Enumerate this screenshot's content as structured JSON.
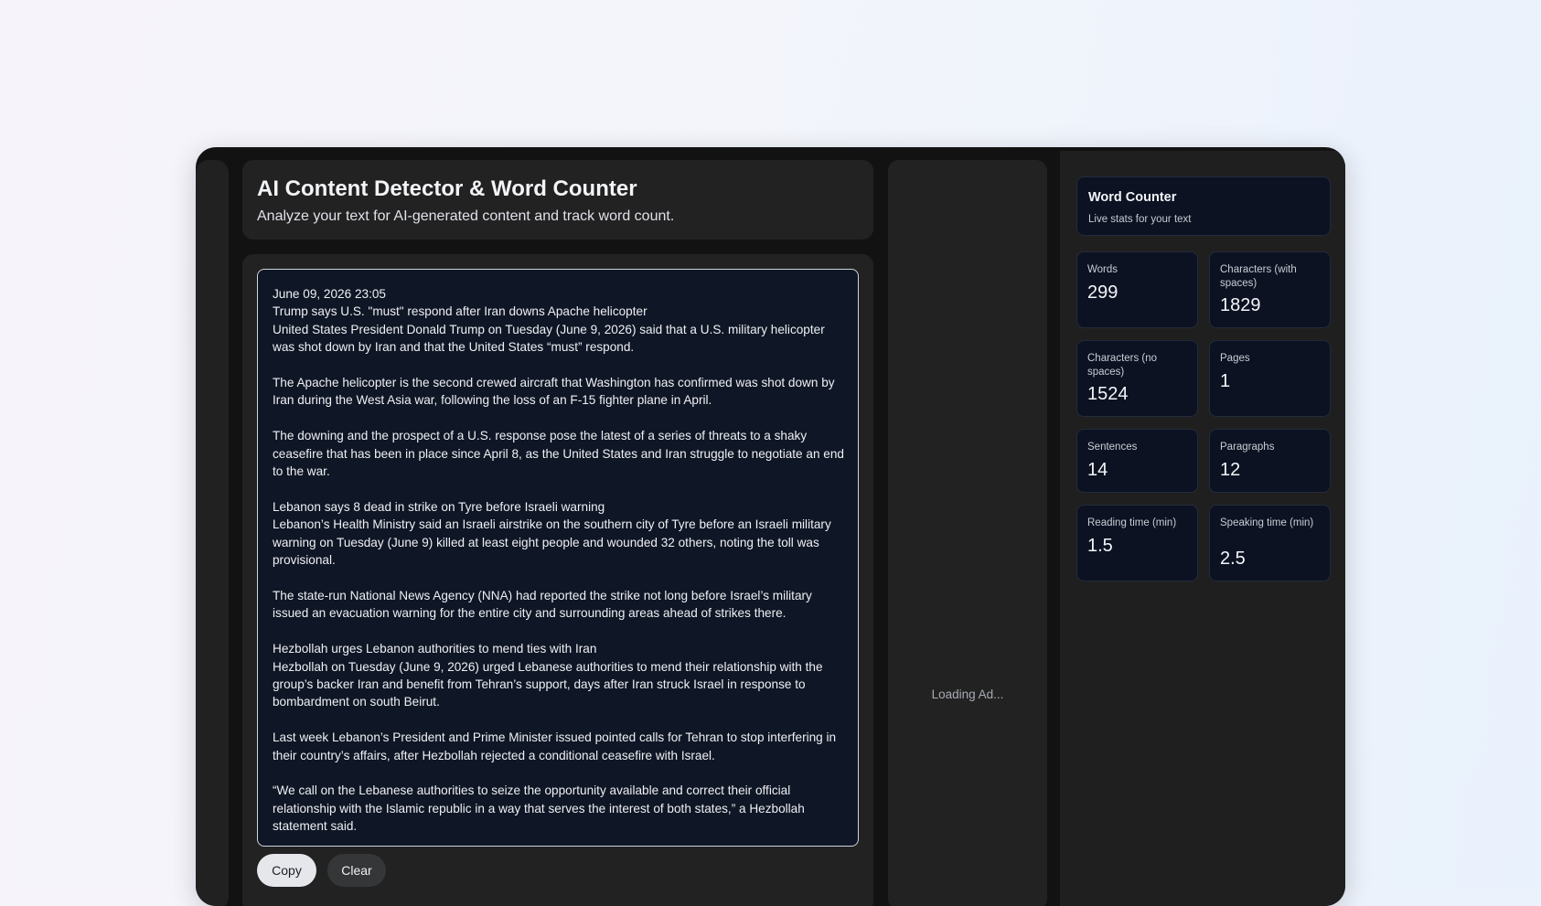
{
  "header": {
    "title": "AI Content Detector & Word Counter",
    "subtitle": "Analyze your text for AI-generated content and track word count."
  },
  "editor": {
    "text": "June 09, 2026 23:05\nTrump says U.S. \"must\" respond after Iran downs Apache helicopter\nUnited States President Donald Trump on Tuesday (June 9, 2026) said that a U.S. military helicopter was shot down by Iran and that the United States “must” respond.\n\nThe Apache helicopter is the second crewed aircraft that Washington has confirmed was shot down by Iran during the West Asia war, following the loss of an F-15 fighter plane in April.\n\nThe downing and the prospect of a U.S. response pose the latest of a series of threats to a shaky ceasefire that has been in place since April 8, as the United States and Iran struggle to negotiate an end to the war.\n\nLebanon says 8 dead in strike on Tyre before Israeli warning\nLebanon’s Health Ministry said an Israeli airstrike on the southern city of Tyre before an Israeli military warning on Tuesday (June 9) killed at least eight people and wounded 32 others, noting the toll was provisional.\n\nThe state-run National News Agency (NNA) had reported the strike not long before Israel’s military issued an evacuation warning for the entire city and surrounding areas ahead of strikes there.\n\nHezbollah urges Lebanon authorities to mend ties with Iran\nHezbollah on Tuesday (June 9, 2026) urged Lebanese authorities to mend their relationship with the group’s backer Iran and benefit from Tehran’s support, days after Iran struck Israel in response to bombardment on south Beirut.\n\nLast week Lebanon’s President and Prime Minister issued pointed calls for Tehran to stop interfering in their country’s affairs, after Hezbollah rejected a conditional ceasefire with Israel.\n\n“We call on the Lebanese authorities to seize the opportunity available and correct their official relationship with the Islamic republic in a way that serves the interest of both states,” a Hezbollah statement said."
  },
  "buttons": {
    "copy": "Copy",
    "clear": "Clear"
  },
  "ad": {
    "loading": "Loading Ad..."
  },
  "word_counter": {
    "title": "Word Counter",
    "subtitle": "Live stats for your text",
    "stats": {
      "words": {
        "label": "Words",
        "value": "299"
      },
      "chars_with_spaces": {
        "label": "Characters (with spaces)",
        "value": "1829"
      },
      "chars_no_spaces": {
        "label": "Characters (no spaces)",
        "value": "1524"
      },
      "pages": {
        "label": "Pages",
        "value": "1"
      },
      "sentences": {
        "label": "Sentences",
        "value": "14"
      },
      "paragraphs": {
        "label": "Paragraphs",
        "value": "12"
      },
      "reading_time": {
        "label": "Reading time (min)",
        "value": "1.5"
      },
      "speaking_time": {
        "label": "Speaking time (min)",
        "value": "2.5"
      }
    }
  },
  "colors": {
    "window_bg": "#121212",
    "panel_bg": "#222222",
    "editor_bg": "#0f1625",
    "stat_card_bg": "#0c1222",
    "copy_button_bg": "#e5e7eb"
  }
}
